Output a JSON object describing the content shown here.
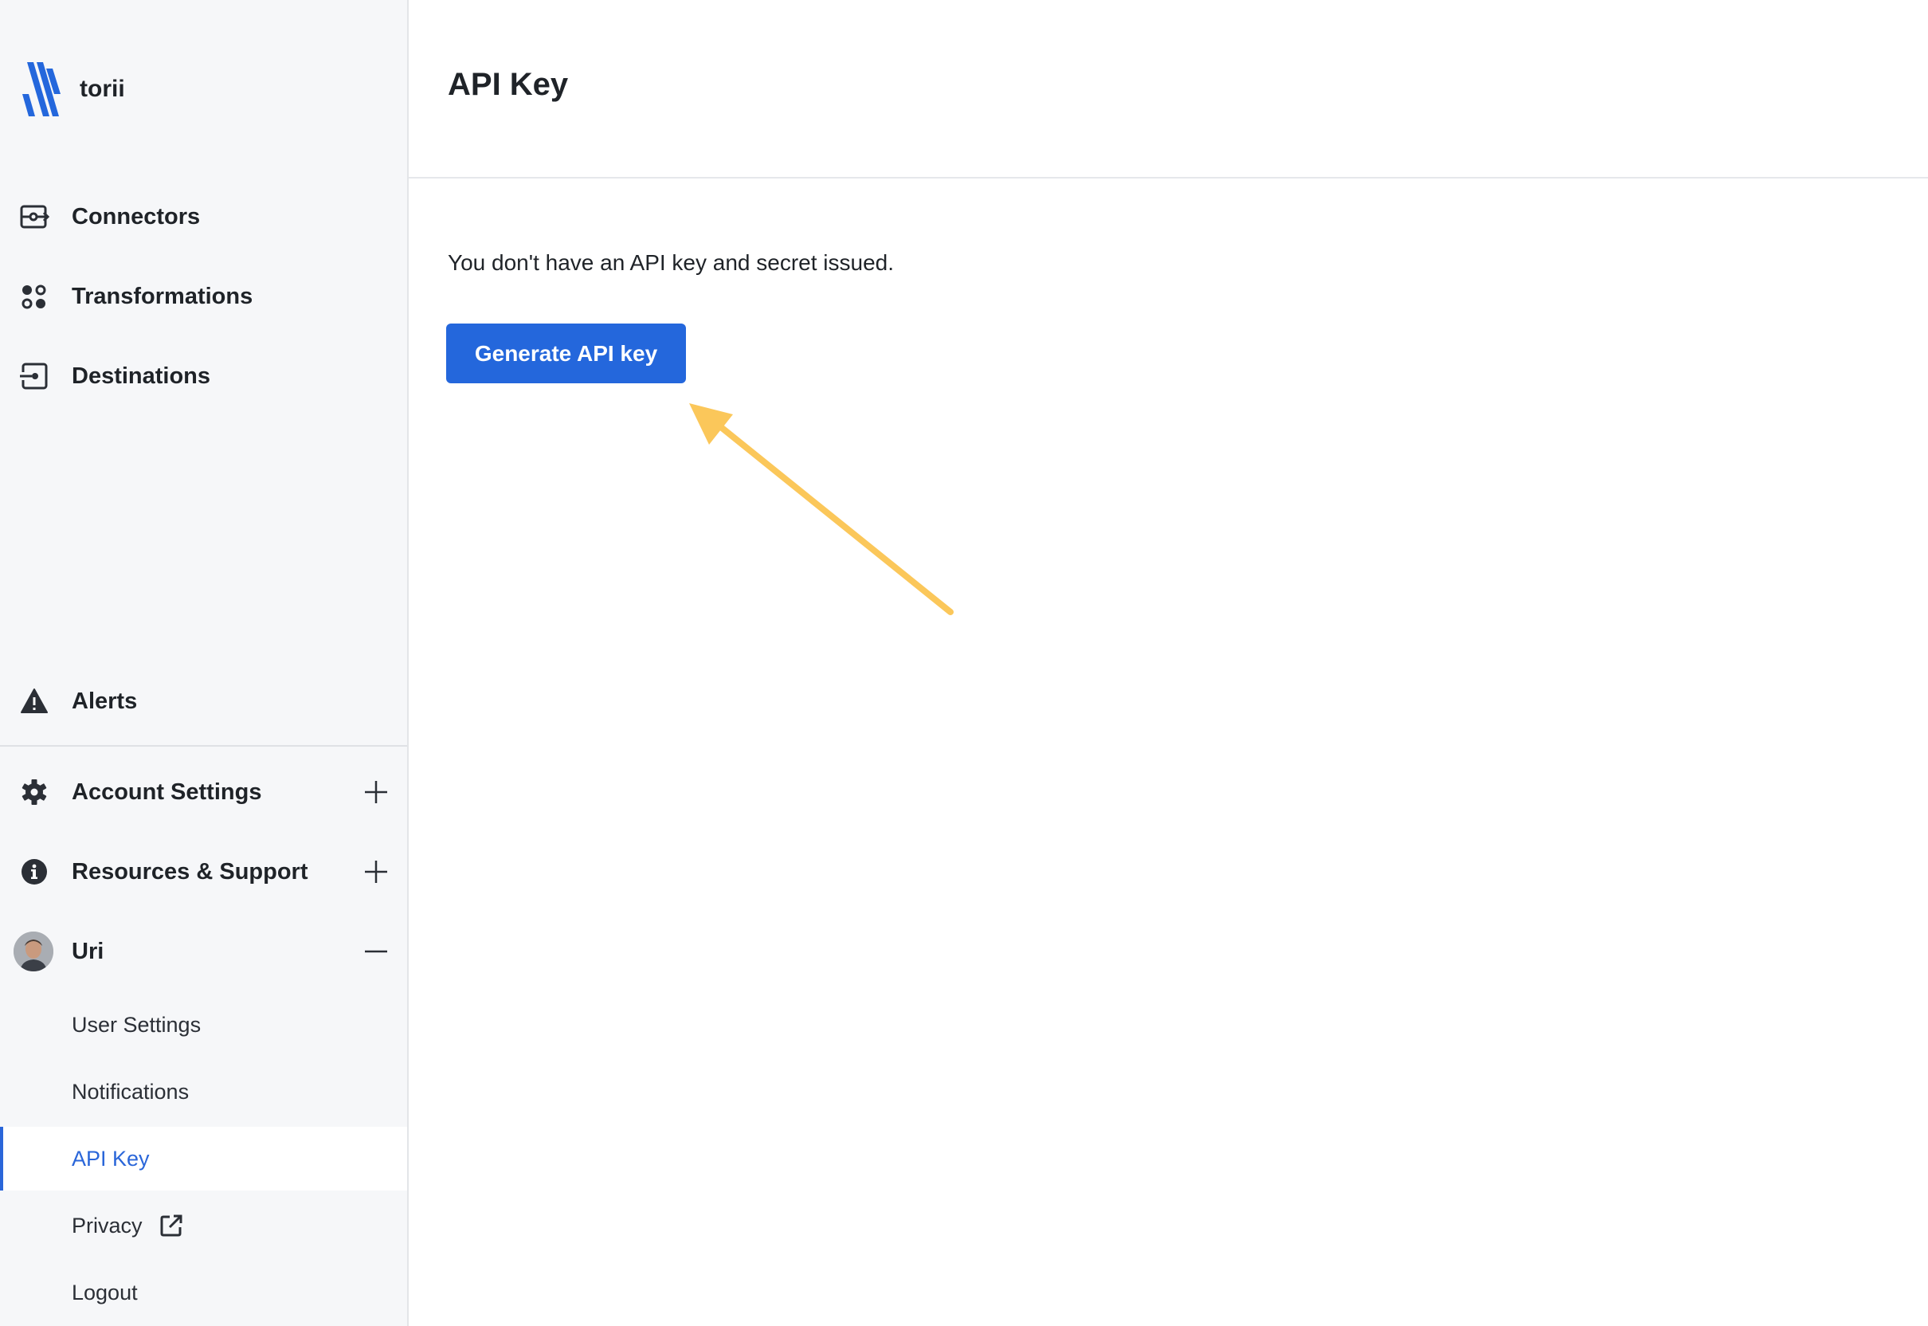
{
  "brand": {
    "name": "torii",
    "accent": "#2467dc"
  },
  "sidebar": {
    "nav_items": [
      {
        "label": "Connectors",
        "icon": "connectors-icon"
      },
      {
        "label": "Transformations",
        "icon": "transformations-icon"
      },
      {
        "label": "Destinations",
        "icon": "destinations-icon"
      }
    ],
    "alerts": {
      "label": "Alerts",
      "icon": "warning-icon"
    },
    "account_settings": {
      "label": "Account Settings",
      "icon": "gear-icon",
      "state": "collapsed"
    },
    "resources_support": {
      "label": "Resources & Support",
      "icon": "info-icon",
      "state": "collapsed"
    },
    "user": {
      "name": "Uri",
      "state": "expanded",
      "items": [
        {
          "label": "User Settings"
        },
        {
          "label": "Notifications"
        },
        {
          "label": "API Key",
          "active": true
        },
        {
          "label": "Privacy",
          "icon": "external-link-icon"
        },
        {
          "label": "Logout"
        }
      ]
    }
  },
  "main": {
    "title": "API Key",
    "message": "You don't have an API key and secret issued.",
    "generate_button_label": "Generate API key"
  },
  "colors": {
    "active_nav": "#2a66d9",
    "annotation_arrow": "#fbc75a"
  }
}
